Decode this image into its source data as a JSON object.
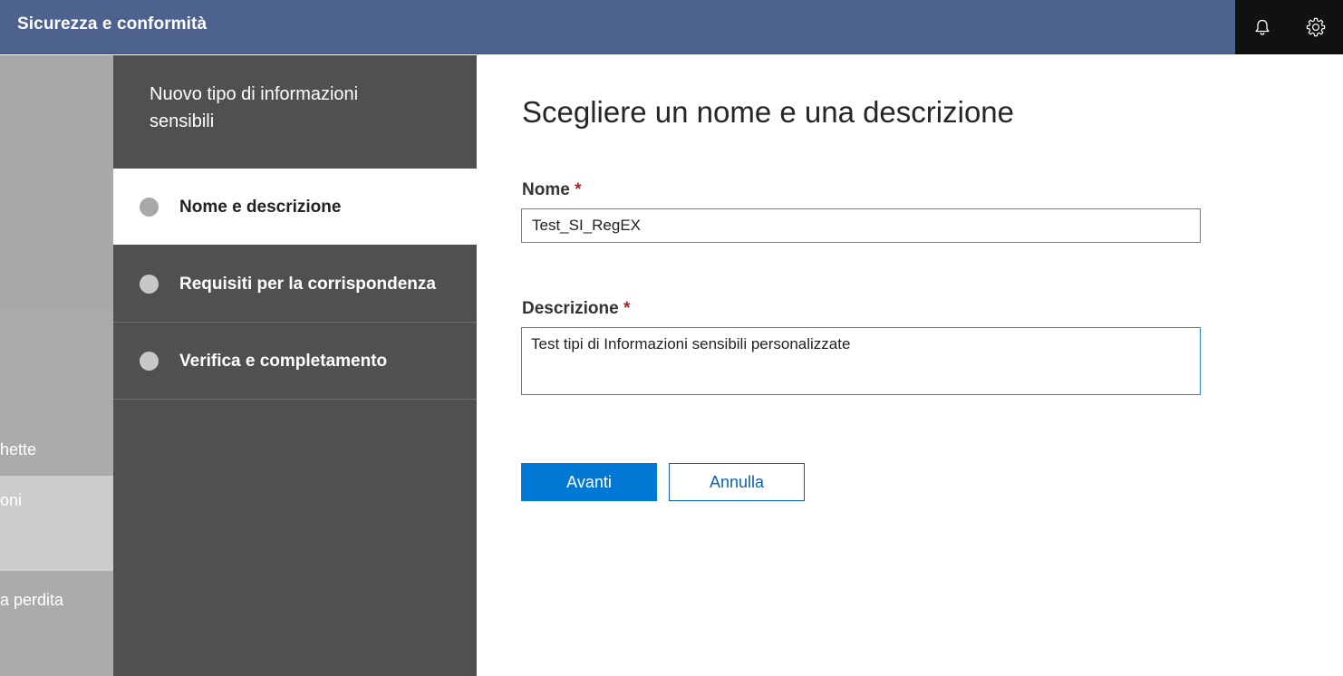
{
  "header": {
    "title": "Sicurezza e conformità",
    "icons": [
      "bell-icon",
      "gear-icon"
    ]
  },
  "background_nav": {
    "items": [
      "hette",
      "oni",
      "a perdita"
    ]
  },
  "wizard": {
    "title": "Nuovo tipo di informazioni sensibili",
    "steps": [
      {
        "label": "Nome e descrizione",
        "active": true
      },
      {
        "label": "Requisiti per la corrispondenza",
        "active": false
      },
      {
        "label": "Verifica e completamento",
        "active": false
      }
    ]
  },
  "form": {
    "title": "Scegliere un nome e una descrizione",
    "name_label": "Nome",
    "required_mark": "*",
    "name_value": "Test_SI_RegEX",
    "description_label": "Descrizione",
    "description_value": "Test tipi di Informazioni sensibili personalizzate "
  },
  "buttons": {
    "next": "Avanti",
    "cancel": "Annulla"
  },
  "colors": {
    "header_bg": "#4e6290",
    "wizard_bg": "#505050",
    "primary": "#0078d4",
    "required": "#a4262c"
  }
}
